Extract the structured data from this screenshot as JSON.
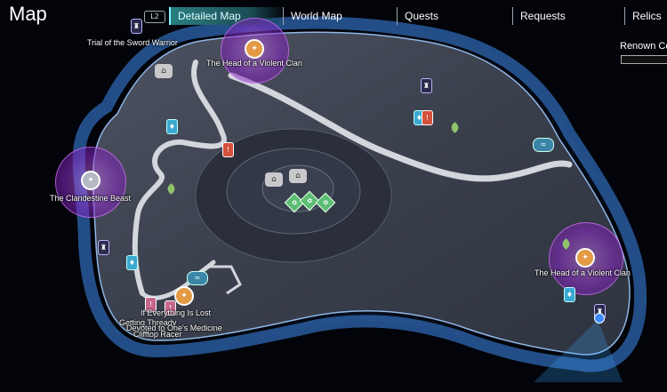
{
  "header": {
    "title": "Map",
    "l2_hint": "L2",
    "tabs": [
      {
        "label": "Detailed Map",
        "active": true
      },
      {
        "label": "World Map"
      },
      {
        "label": "Quests"
      },
      {
        "label": "Requests"
      },
      {
        "label": "Relics"
      }
    ],
    "renown_label": "Renown Co"
  },
  "map_labels": {
    "trial": "Trial of the Sword Warrior",
    "violent_clan_north": "The Head of a Violent Clan",
    "clandestine_beast": "The Clandestine Beast",
    "violent_clan_east": "The Head of a Violent Clan",
    "everything_lost": "If Everything Is Lost",
    "getting_thready": "Getting Thready",
    "medicine": "Devoted to One's Medicine",
    "racer": "Clifftop Racer"
  },
  "colors": {
    "background": "#02040a",
    "accent_tab": "#2a7f7f",
    "boss_zone": "#9b3ad0"
  }
}
